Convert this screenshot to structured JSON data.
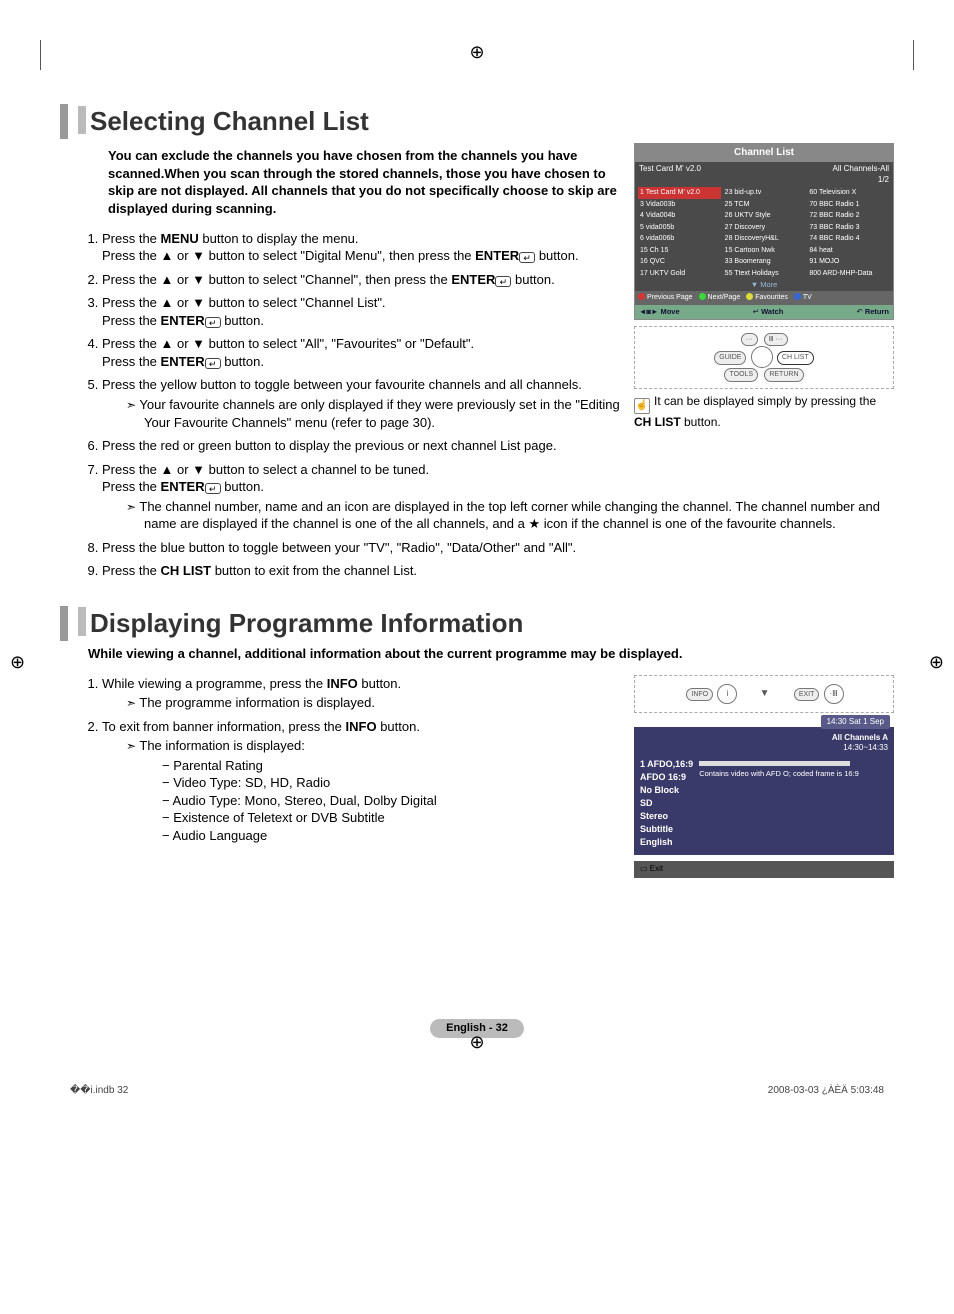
{
  "section1": {
    "title": "Selecting Channel List",
    "intro": "You can exclude the channels you have chosen from the channels you have scanned.When you scan through the stored channels, those you have chosen to skip are not displayed. All channels that you do not specifically choose to skip are displayed during scanning.",
    "step1a": "Press the ",
    "step1b": " button to display the menu.",
    "step1c": "Press the ▲ or ▼ button to select \"Digital Menu\", then press the ",
    "step1d": " button.",
    "step2a": "Press the ▲ or ▼ button to select \"Channel\", then press the ",
    "step2b": " button.",
    "step3a": "Press the ▲ or ▼ button to select \"Channel List\".",
    "step3b": "Press the ",
    "step3c": " button.",
    "step4a": "Press the ▲ or ▼ button to select \"All\", \"Favourites\" or \"Default\".",
    "step4b": "Press the ",
    "step4c": " button.",
    "step5": "Press the yellow button to toggle between your favourite channels and all channels.",
    "step5note": "Your favourite channels are only displayed if they were previously set in the \"Editing Your Favourite Channels\" menu (refer to page 30).",
    "step6": "Press the red or green button to display the previous or next channel List page.",
    "step7a": "Press the ▲ or ▼ button to select a channel to be tuned.",
    "step7b": "Press the ",
    "step7c": " button.",
    "step7note": "The channel number, name and an icon are displayed in the top left corner while changing the channel. The channel number and name are displayed if the channel is one of the all channels, and a ★ icon if the channel is one of the favourite channels.",
    "step8": "Press the blue button to toggle between your \"TV\", \"Radio\", \"Data/Other\" and \"All\".",
    "step9a": "Press the ",
    "step9b": " button to exit from the channel List.",
    "menu": "MENU",
    "enter": "ENTER",
    "chlist": "CH LIST"
  },
  "tv": {
    "title": "Channel List",
    "subL": "Test Card M' v2.0",
    "subR": "All Channels-All",
    "page": "1/2",
    "col1": [
      "1  Test Card M' v2.0",
      "3  Vida003b",
      "4  Vida004b",
      "5  vida005b",
      "6  vida006b",
      "15  Ch 15",
      "16  QVC",
      "17  UKTV Gold"
    ],
    "col2": [
      "23  bid-up.tv",
      "25  TCM",
      "26  UKTV Style",
      "27  Discovery",
      "28  DiscoveryH&L",
      "15  Cartoon Nwk",
      "33  Boomerang",
      "55  Ttext Holidays"
    ],
    "col3": [
      "60  Television X",
      "70  BBC Radio 1",
      "72  BBC Radio 2",
      "73  BBC Radio 3",
      "74  BBC Radio 4",
      "84  heat",
      "91  MOJO",
      "800  ARD-MHP-Data"
    ],
    "more": "▼  More",
    "legPrev": "Previous Page",
    "legNext": "Next/Page",
    "legFav": "Favourites",
    "legTv": "TV",
    "move": "Move",
    "watch": "Watch",
    "return": "Return",
    "btnGuide": "GUIDE",
    "btnCh": "CH LIST",
    "btnTools": "TOOLS",
    "btnReturn": "RETURN"
  },
  "sideNote1": "It can be displayed simply by pressing the ",
  "sideNote2": " button.",
  "section2": {
    "title": "Displaying Programme Information",
    "intro": "While viewing a channel, additional information about the current programme may be displayed.",
    "step1a": "While viewing a programme, press the ",
    "step1b": " button.",
    "step1note": "The programme information is displayed.",
    "step2a": "To exit from banner information, press the ",
    "step2b": " button.",
    "step2note": "The information is displayed:",
    "info": "INFO",
    "bullets": [
      "− Parental Rating",
      "− Video Type: SD, HD, Radio",
      "− Audio Type: Mono, Stereo, Dual, Dolby Digital",
      "− Existence of Teletext or DVB Subtitle",
      "− Audio Language"
    ],
    "remoteInfo": "INFO",
    "remoteExit": "EXIT"
  },
  "banner": {
    "time": "14:30 Sat 1 Sep",
    "rightHead": "All Channels    A",
    "rightTime": "14:30~14:33",
    "l1": "1 AFDO,16:9",
    "l2": "AFDO 16:9",
    "l3": "No Block",
    "l4": "SD",
    "l5": "Stereo",
    "l6": "Subtitle",
    "l7": "English",
    "desc": "Contains video with AFD O; coded frame is 16:9",
    "exit": "Exit"
  },
  "footer": {
    "page": "English - 32",
    "docL": "��i.indb   32",
    "docR": "2008-03-03   ¿ÀÈÄ 5:03:48"
  }
}
